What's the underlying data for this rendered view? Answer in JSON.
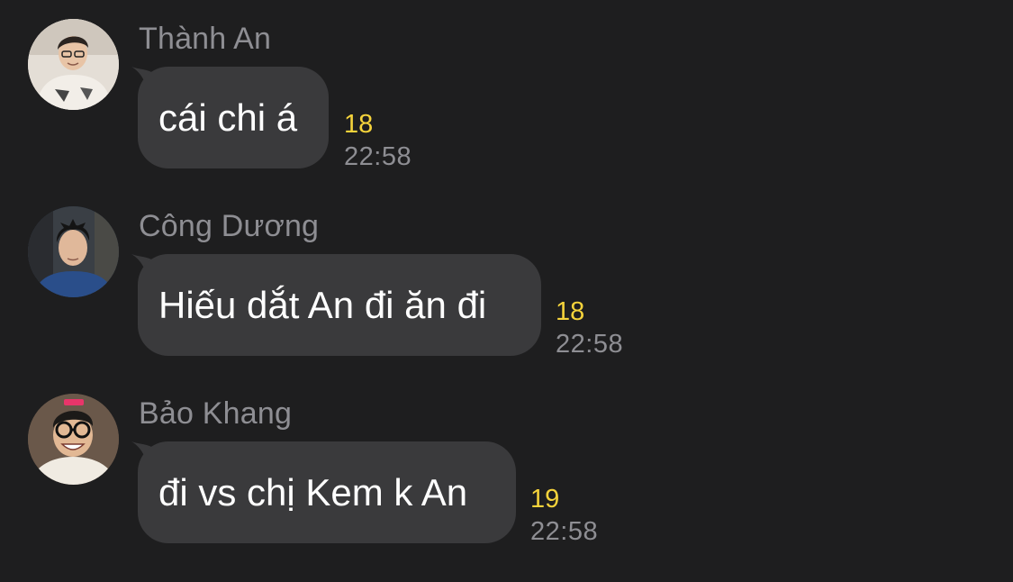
{
  "messages": [
    {
      "sender": "Thành An",
      "text": "cái chi á",
      "count": "18",
      "time": "22:58",
      "avatar_color": "#d8d2c8"
    },
    {
      "sender": "Công Dương",
      "text": "Hiếu dắt An đi ăn đi",
      "count": "18",
      "time": "22:58",
      "avatar_color": "#243a52"
    },
    {
      "sender": "Bảo Khang",
      "text": "đi vs chị Kem k An",
      "count": "19",
      "time": "22:58",
      "avatar_color": "#5a4a3e"
    }
  ]
}
